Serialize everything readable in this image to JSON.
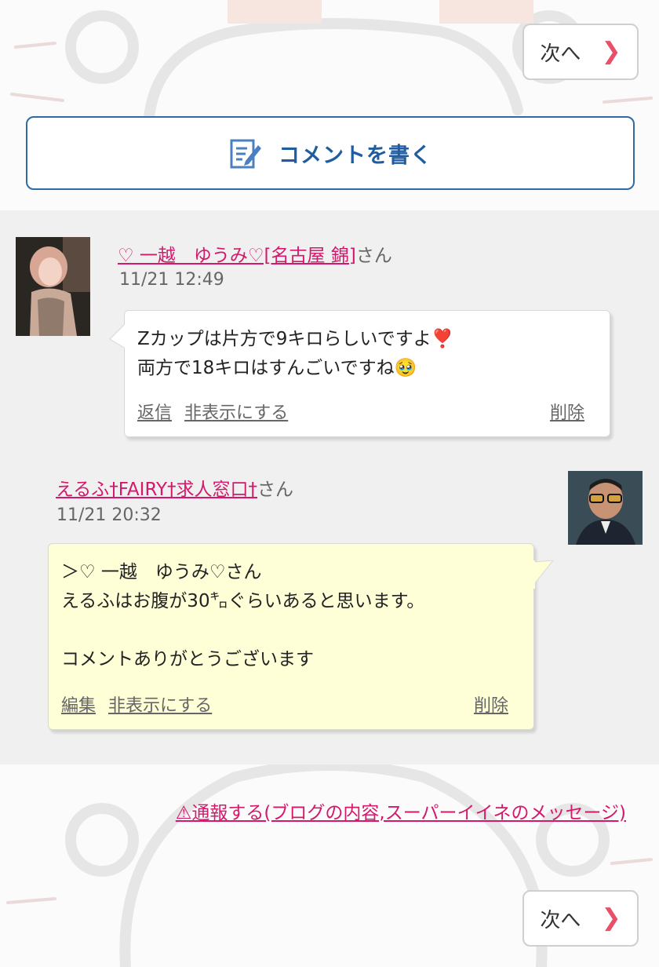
{
  "nav": {
    "next_label": "次へ",
    "next_icon": "chevron-right-icon"
  },
  "write_comment": {
    "label": "コメントを書く",
    "icon": "edit-note-icon"
  },
  "comments": [
    {
      "author": "♡ 一越　ゆうみ♡[名古屋 錦]",
      "suffix": "さん",
      "time": "11/21 12:49",
      "line1": "Zカップは片方で9キロらしいですよ❣️",
      "line2": "両方で18キロはすんごいですね🥹",
      "actions": [
        "返信",
        "非表示にする"
      ],
      "delete": "削除"
    },
    {
      "author": "えるふ†FAIRY†求人窓口†",
      "suffix": "さん",
      "time": "11/21 20:32",
      "line1": "＞♡ 一越　ゆうみ♡さん",
      "line2": "えるふはお腹が30㌔ぐらいあると思います。",
      "line3": "コメントありがとうございます",
      "actions": [
        "編集",
        "非表示にする"
      ],
      "delete": "削除"
    }
  ],
  "report": "⚠通報する(ブログの内容,スーパーイイネのメッセージ)",
  "colors": {
    "accent_pink": "#d4196c",
    "write_blue": "#1f5da0",
    "chevron": "#e8506a",
    "reply_bg": "#fefed7"
  }
}
